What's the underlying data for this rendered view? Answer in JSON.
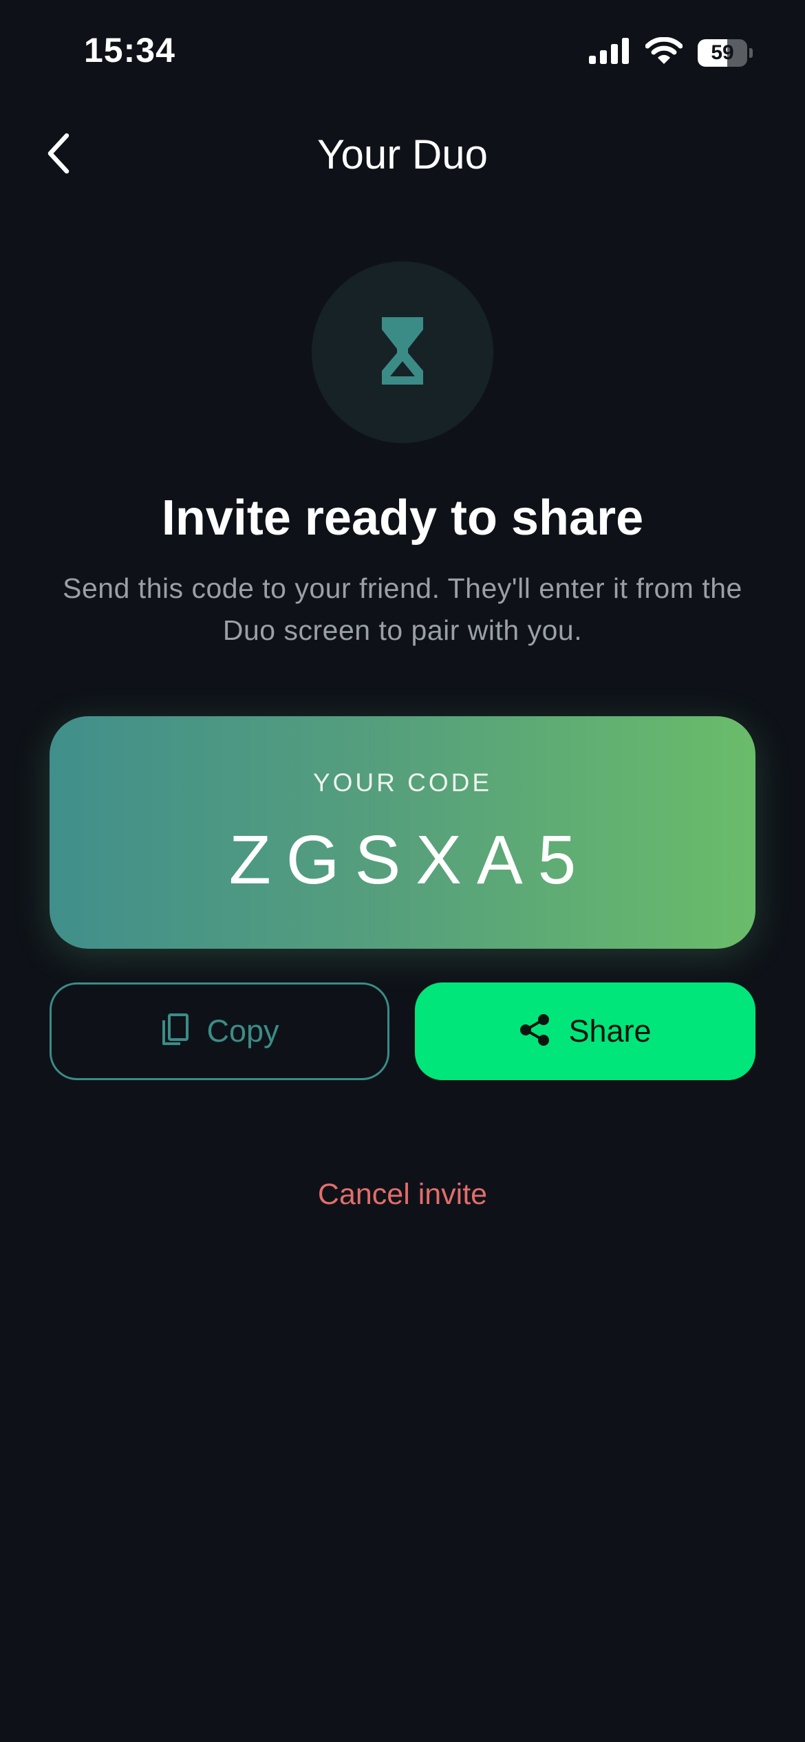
{
  "status_bar": {
    "time": "15:34",
    "battery_level": "59",
    "battery_fraction": 0.59,
    "icons": [
      "cellular-signal-icon",
      "wifi-icon",
      "battery-icon"
    ]
  },
  "nav": {
    "title": "Your Duo",
    "back_icon": "chevron-left-icon"
  },
  "hero": {
    "icon": "hourglass-icon",
    "headline": "Invite ready to share",
    "subtext": "Send this code to your friend. They'll enter it from the Duo screen to pair with you."
  },
  "code_card": {
    "label": "YOUR CODE",
    "code": "ZGSXA5"
  },
  "actions": {
    "copy_label": "Copy",
    "copy_icon": "copy-icon",
    "share_label": "Share",
    "share_icon": "share-icon"
  },
  "cancel_label": "Cancel invite",
  "colors": {
    "background": "#0e1218",
    "accent_green": "#00e67a",
    "teal": "#3b8c87",
    "cancel_red": "#e26d6b",
    "card_gradient_start": "#418f8b",
    "card_gradient_end": "#6abc6a"
  }
}
